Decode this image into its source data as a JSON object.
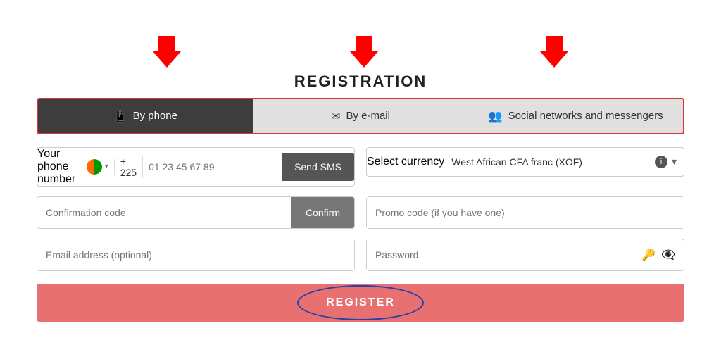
{
  "page": {
    "title": "REGISTRATION",
    "arrows": [
      "↓",
      "↓",
      "↓"
    ]
  },
  "tabs": [
    {
      "id": "phone",
      "label": "By phone",
      "icon": "📱",
      "active": true
    },
    {
      "id": "email",
      "label": "By e-mail",
      "icon": "✉",
      "active": false
    },
    {
      "id": "social",
      "label": "Social networks and messengers",
      "icon": "👥",
      "active": false
    }
  ],
  "form": {
    "phone_label": "Your phone number",
    "phone_code": "+ 225",
    "phone_placeholder": "01 23 45 67 89",
    "send_sms_label": "Send SMS",
    "currency_label": "Select currency",
    "currency_value": "West African CFA franc (XOF)",
    "confirmation_placeholder": "Confirmation code",
    "confirm_label": "Confirm",
    "promo_placeholder": "Promo code (if you have one)",
    "email_placeholder": "Email address (optional)",
    "password_placeholder": "Password",
    "register_label": "REGISTER"
  }
}
